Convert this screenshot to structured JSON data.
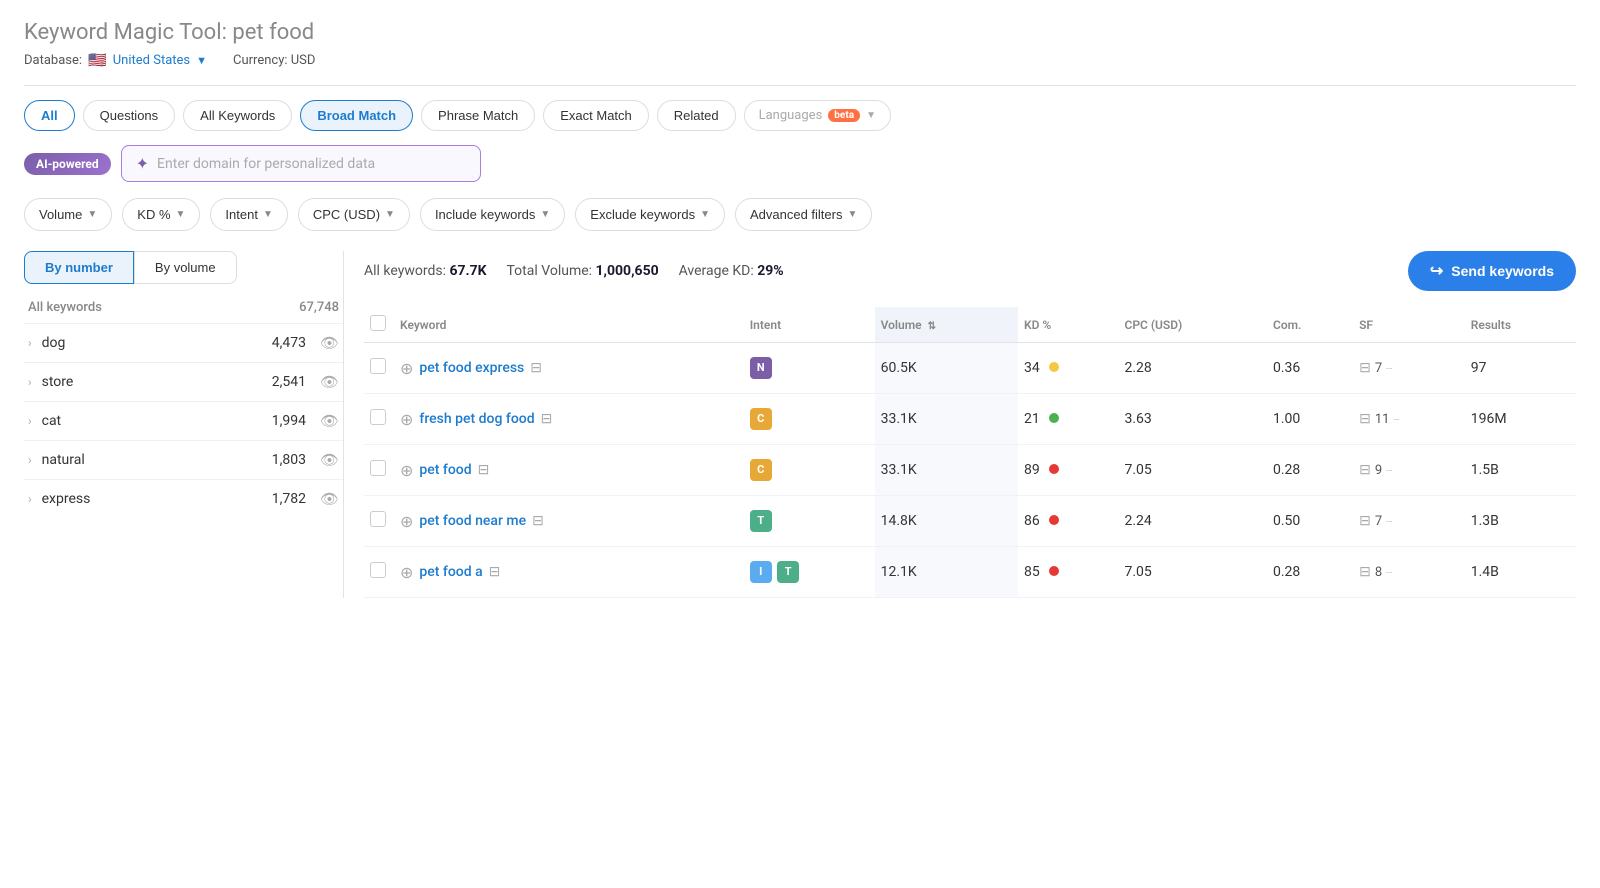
{
  "header": {
    "title": "Keyword Magic Tool:",
    "keyword": "pet food",
    "db_label": "Database:",
    "db_country": "United States",
    "currency_label": "Currency: USD"
  },
  "tabs": [
    {
      "id": "all",
      "label": "All",
      "active": true
    },
    {
      "id": "questions",
      "label": "Questions",
      "active": false
    },
    {
      "id": "all-keywords",
      "label": "All Keywords",
      "active": false
    },
    {
      "id": "broad-match",
      "label": "Broad Match",
      "active": false,
      "selected": true
    },
    {
      "id": "phrase-match",
      "label": "Phrase Match",
      "active": false
    },
    {
      "id": "exact-match",
      "label": "Exact Match",
      "active": false
    },
    {
      "id": "related",
      "label": "Related",
      "active": false
    }
  ],
  "languages_tab": {
    "label": "Languages",
    "badge": "beta"
  },
  "ai_section": {
    "badge": "AI-powered",
    "placeholder": "Enter domain for personalized data"
  },
  "filters": [
    {
      "id": "volume",
      "label": "Volume"
    },
    {
      "id": "kd",
      "label": "KD %"
    },
    {
      "id": "intent",
      "label": "Intent"
    },
    {
      "id": "cpc",
      "label": "CPC (USD)"
    },
    {
      "id": "include-keywords",
      "label": "Include keywords"
    },
    {
      "id": "exclude-keywords",
      "label": "Exclude keywords"
    },
    {
      "id": "advanced-filters",
      "label": "Advanced filters"
    }
  ],
  "sidebar": {
    "tab1": "By number",
    "tab2": "By volume",
    "col1": "All keywords",
    "col2": "67,748",
    "items": [
      {
        "label": "dog",
        "count": "4,473"
      },
      {
        "label": "store",
        "count": "2,541"
      },
      {
        "label": "cat",
        "count": "1,994"
      },
      {
        "label": "natural",
        "count": "1,803"
      },
      {
        "label": "express",
        "count": "1,782"
      }
    ]
  },
  "table_summary": {
    "all_keywords_label": "All keywords:",
    "all_keywords_value": "67.7K",
    "total_volume_label": "Total Volume:",
    "total_volume_value": "1,000,650",
    "avg_kd_label": "Average KD:",
    "avg_kd_value": "29%"
  },
  "send_keywords_btn": "Send keywords",
  "table": {
    "headers": [
      "",
      "Keyword",
      "Intent",
      "Volume",
      "KD %",
      "CPC (USD)",
      "Com.",
      "SF",
      "Results"
    ],
    "rows": [
      {
        "keyword": "pet food express",
        "intent": "N",
        "intent_type": "n",
        "volume": "60.5K",
        "kd": "34",
        "kd_dot": "yellow",
        "cpc": "2.28",
        "com": "0.36",
        "sf": "7",
        "results": "97"
      },
      {
        "keyword": "fresh pet dog food",
        "intent": "C",
        "intent_type": "c",
        "volume": "33.1K",
        "kd": "21",
        "kd_dot": "green",
        "cpc": "3.63",
        "com": "1.00",
        "sf": "11",
        "results": "196M"
      },
      {
        "keyword": "pet food",
        "intent": "C",
        "intent_type": "c",
        "volume": "33.1K",
        "kd": "89",
        "kd_dot": "red",
        "cpc": "7.05",
        "com": "0.28",
        "sf": "9",
        "results": "1.5B"
      },
      {
        "keyword": "pet food near me",
        "intent": "T",
        "intent_type": "t",
        "volume": "14.8K",
        "kd": "86",
        "kd_dot": "red",
        "cpc": "2.24",
        "com": "0.50",
        "sf": "7",
        "results": "1.3B"
      },
      {
        "keyword": "pet food a",
        "intent_multi": [
          "I",
          "T"
        ],
        "intent_types": [
          "i",
          "t"
        ],
        "volume": "12.1K",
        "kd": "85",
        "kd_dot": "red",
        "cpc": "7.05",
        "com": "0.28",
        "sf": "8",
        "results": "1.4B"
      }
    ]
  }
}
